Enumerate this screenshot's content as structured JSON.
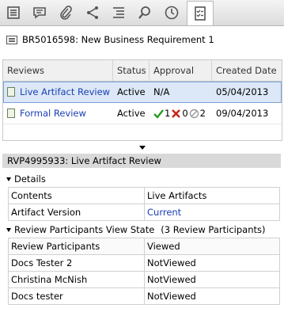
{
  "toolbar": {
    "tabs": [
      {
        "icon": "document-list-icon"
      },
      {
        "icon": "comment-icon"
      },
      {
        "icon": "paperclip-icon"
      },
      {
        "icon": "share-icon"
      },
      {
        "icon": "outline-list-icon"
      },
      {
        "icon": "search-icon"
      },
      {
        "icon": "clock-icon"
      },
      {
        "icon": "checklist-icon",
        "active": true
      }
    ]
  },
  "requirement": {
    "title": "BR5016598: New Business Requirement 1"
  },
  "reviews_grid": {
    "columns": [
      "Reviews",
      "Status",
      "Approval",
      "Created Date"
    ],
    "rows": [
      {
        "name": "Live Artifact Review",
        "status": "Active",
        "approval": "N/A",
        "created": "05/04/2013"
      },
      {
        "name": "Formal Review",
        "status": "Active",
        "approved": "1",
        "rejected": "0",
        "abstained": "2",
        "created": "09/04/2013"
      }
    ]
  },
  "detail": {
    "title": "RVP4995933: Live Artifact Review",
    "details_label": "Details",
    "properties": [
      {
        "key": "Contents",
        "value": "Live Artifacts"
      },
      {
        "key": "Artifact Version",
        "value": "Current"
      }
    ],
    "participants_label": "Review Participants View State",
    "participants_count": "(3 Review Participants)",
    "participants_columns": [
      "Review Participants",
      "Viewed"
    ],
    "participants": [
      {
        "name": "Docs Tester 2",
        "state": "NotViewed"
      },
      {
        "name": "Christina McNish",
        "state": "NotViewed"
      },
      {
        "name": "Docs tester",
        "state": "NotViewed"
      }
    ]
  },
  "colors": {
    "link": "#1a3fb6",
    "selected_row": "#dce8f7",
    "approve": "#2a9a1e",
    "reject": "#c8201a",
    "abstain": "#9a9a9a"
  }
}
